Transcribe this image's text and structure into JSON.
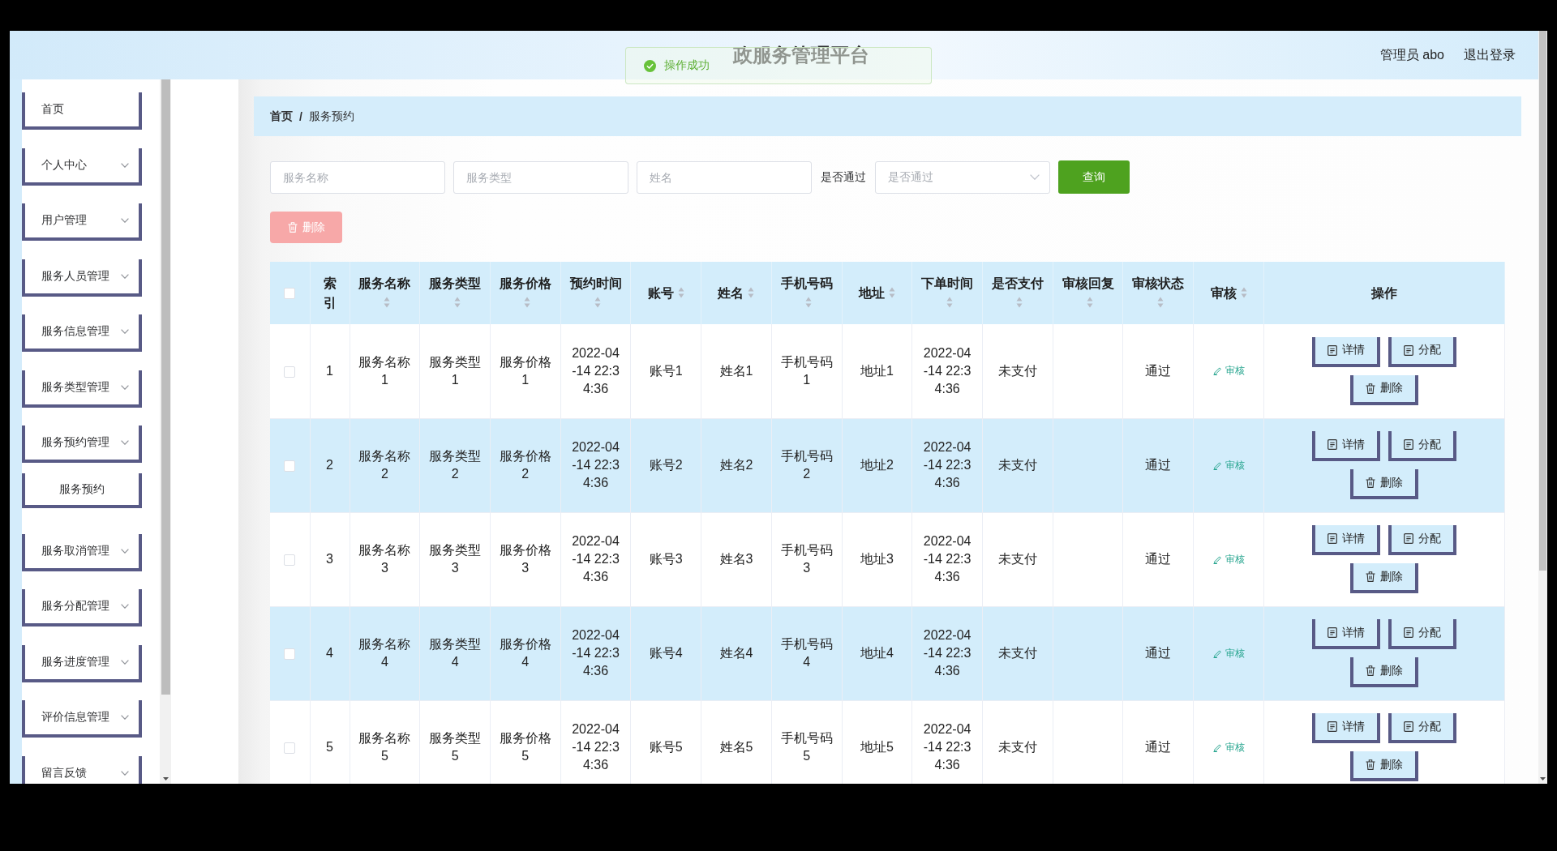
{
  "header": {
    "title": "政服务管理平台",
    "user": "管理员 abo",
    "logout": "退出登录"
  },
  "toast": {
    "kind": "success",
    "message": "操作成功"
  },
  "sidebar": {
    "items": [
      {
        "kind": "link",
        "label": "首页"
      },
      {
        "kind": "menu",
        "label": "个人中心"
      },
      {
        "kind": "menu",
        "label": "用户管理"
      },
      {
        "kind": "menu",
        "label": "服务人员管理"
      },
      {
        "kind": "menu",
        "label": "服务信息管理"
      },
      {
        "kind": "menu",
        "label": "服务类型管理"
      },
      {
        "kind": "menu",
        "label": "服务预约管理",
        "children": [
          {
            "label": "服务预约"
          }
        ]
      },
      {
        "kind": "menu",
        "label": "服务取消管理"
      },
      {
        "kind": "menu",
        "label": "服务分配管理"
      },
      {
        "kind": "menu",
        "label": "服务进度管理"
      },
      {
        "kind": "menu",
        "label": "评价信息管理"
      },
      {
        "kind": "menu",
        "label": "留言反馈"
      }
    ]
  },
  "breadcrumb": {
    "items": [
      "首页",
      "服务预约"
    ],
    "separator": "/"
  },
  "search": {
    "fields": [
      {
        "placeholder": "服务名称"
      },
      {
        "placeholder": "服务类型"
      },
      {
        "placeholder": "姓名"
      }
    ],
    "filter": {
      "label": "是否通过",
      "placeholder": "是否通过"
    },
    "query_button": "查询"
  },
  "toolbar": {
    "delete_button": {
      "label": "删除",
      "disabled": true
    }
  },
  "table": {
    "select_all": {
      "checked": false
    },
    "columns": [
      {
        "kind": "index",
        "label": "索引",
        "sortable": false
      },
      {
        "kind": "text",
        "label": "服务名称",
        "sortable": true
      },
      {
        "kind": "text",
        "label": "服务类型",
        "sortable": true
      },
      {
        "kind": "text",
        "label": "服务价格",
        "sortable": true
      },
      {
        "kind": "time",
        "label": "预约时间",
        "sortable": true
      },
      {
        "kind": "text",
        "label": "账号",
        "sortable": true
      },
      {
        "kind": "text",
        "label": "姓名",
        "sortable": true
      },
      {
        "kind": "text",
        "label": "手机号码",
        "sortable": true
      },
      {
        "kind": "text",
        "label": "地址",
        "sortable": true
      },
      {
        "kind": "time",
        "label": "下单时间",
        "sortable": true
      },
      {
        "kind": "text",
        "label": "是否支付",
        "sortable": true
      },
      {
        "kind": "reply",
        "label": "审核回复",
        "sortable": true
      },
      {
        "kind": "status",
        "label": "审核状态",
        "sortable": true
      },
      {
        "kind": "review",
        "label": "审核",
        "sortable": true
      },
      {
        "kind": "actions",
        "label": "操作",
        "sortable": false
      }
    ],
    "rows": [
      {
        "checked": false,
        "cells": [
          "1",
          "服务名称1",
          "服务类型1",
          "服务价格1",
          "2022-04-14 22:34:36",
          "账号1",
          "姓名1",
          "手机号码1",
          "地址1",
          "2022-04-14 22:34:36",
          "未支付"
        ],
        "review_status": "通过",
        "review": "审核",
        "actions": [
          {
            "kind": "detail",
            "label": "详情"
          },
          {
            "kind": "assign",
            "label": "分配"
          },
          {
            "kind": "delete",
            "label": "删除"
          }
        ]
      },
      {
        "checked": false,
        "cells": [
          "2",
          "服务名称2",
          "服务类型2",
          "服务价格2",
          "2022-04-14 22:34:36",
          "账号2",
          "姓名2",
          "手机号码2",
          "地址2",
          "2022-04-14 22:34:36",
          "未支付"
        ],
        "review_status": "通过",
        "review": "审核",
        "actions": [
          {
            "kind": "detail",
            "label": "详情"
          },
          {
            "kind": "assign",
            "label": "分配"
          },
          {
            "kind": "delete",
            "label": "删除"
          }
        ]
      },
      {
        "checked": false,
        "cells": [
          "3",
          "服务名称3",
          "服务类型3",
          "服务价格3",
          "2022-04-14 22:34:36",
          "账号3",
          "姓名3",
          "手机号码3",
          "地址3",
          "2022-04-14 22:34:36",
          "未支付"
        ],
        "review_status": "通过",
        "review": "审核",
        "actions": [
          {
            "kind": "detail",
            "label": "详情"
          },
          {
            "kind": "assign",
            "label": "分配"
          },
          {
            "kind": "delete",
            "label": "删除"
          }
        ]
      },
      {
        "checked": false,
        "cells": [
          "4",
          "服务名称4",
          "服务类型4",
          "服务价格4",
          "2022-04-14 22:34:36",
          "账号4",
          "姓名4",
          "手机号码4",
          "地址4",
          "2022-04-14 22:34:36",
          "未支付"
        ],
        "review_status": "通过",
        "review": "审核",
        "actions": [
          {
            "kind": "detail",
            "label": "详情"
          },
          {
            "kind": "assign",
            "label": "分配"
          },
          {
            "kind": "delete",
            "label": "删除"
          }
        ]
      },
      {
        "checked": false,
        "cells": [
          "5",
          "服务名称5",
          "服务类型5",
          "服务价格5",
          "2022-04-14 22:34:36",
          "账号5",
          "姓名5",
          "手机号码5",
          "地址5",
          "2022-04-14 22:34:36",
          "未支付"
        ],
        "review_status": "通过",
        "review": "审核",
        "actions": [
          {
            "kind": "detail",
            "label": "详情"
          },
          {
            "kind": "assign",
            "label": "分配"
          },
          {
            "kind": "delete",
            "label": "删除"
          }
        ]
      }
    ]
  }
}
